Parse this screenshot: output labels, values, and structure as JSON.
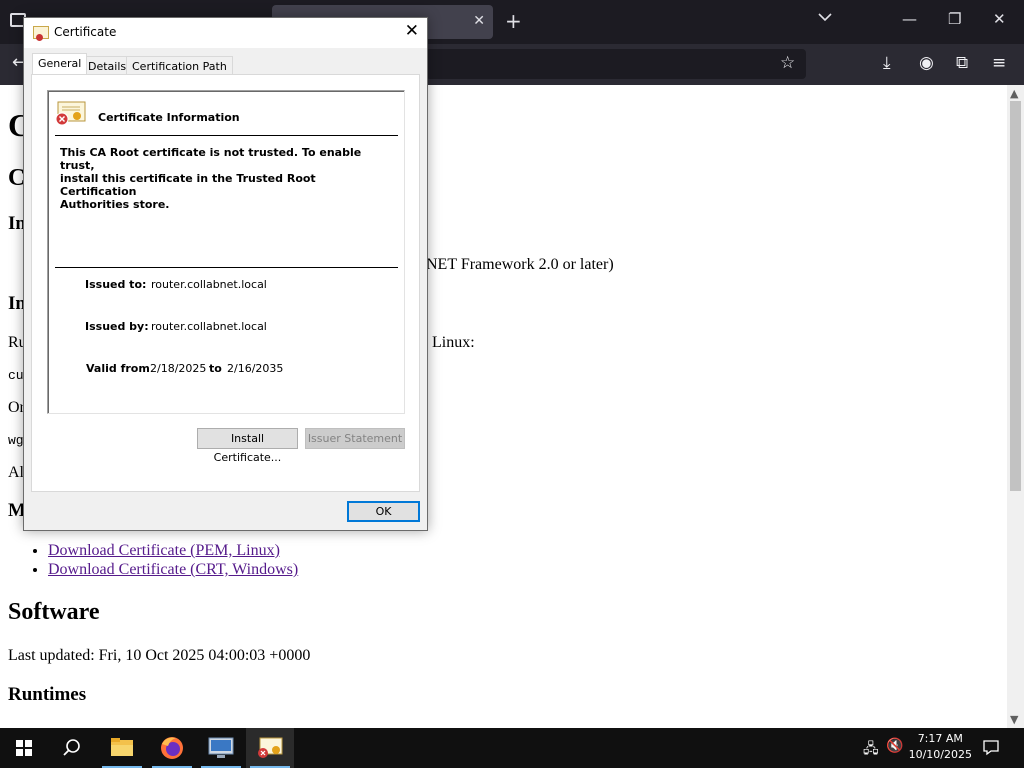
{
  "page": {
    "h1_fragment": "C",
    "h2_fragment": "C",
    "h3_fragment_1": "In",
    "p_fragment_1": "NET Framework 2.0 or later)",
    "h3_fragment_2": "In",
    "p_fragment_2_start": "Ru",
    "p_fragment_2_end": "n Linux:",
    "code_fragment_1": "cu",
    "p_fragment_3": "Or",
    "code_fragment_2": "wg",
    "p_fragment_4": "Al",
    "h3_fragment_3": "M",
    "links": [
      "Download Certificate (PEM, Linux)",
      "Download Certificate (CRT, Windows)"
    ],
    "software_heading": "Software",
    "last_updated": "Last updated: Fri, 10 Oct 2025 04:00:03 +0000",
    "runtimes_heading": "Runtimes"
  },
  "dialog": {
    "title": "Certificate",
    "tabs": [
      "General",
      "Details",
      "Certification Path"
    ],
    "info_title": "Certificate Information",
    "info_desc": "This CA Root certificate is not trusted. To enable trust,\ninstall this certificate in the Trusted Root Certification\nAuthorities store.",
    "issued_to_label": "Issued to:",
    "issued_to_value": "router.collabnet.local",
    "issued_by_label": "Issued by:",
    "issued_by_value": "router.collabnet.local",
    "valid_from_label": "Valid from",
    "valid_from_value": "2/18/2025",
    "valid_to_label": "to",
    "valid_to_value": "2/16/2035",
    "install_button": "Install Certificate...",
    "issuer_button": "Issuer Statement",
    "ok_button": "OK"
  },
  "taskbar": {
    "time": "7:17 AM",
    "date": "10/10/2025",
    "pinned": [
      "file-explorer-icon",
      "firefox-icon",
      "remote-desktop-icon",
      "certificate-icon"
    ]
  },
  "colors": {
    "tabbar": "#1c1b22",
    "navbar": "#2b2a33",
    "visited_link": "#551a8b",
    "ok_focus": "#0078d7",
    "taskbar": "#101010"
  }
}
